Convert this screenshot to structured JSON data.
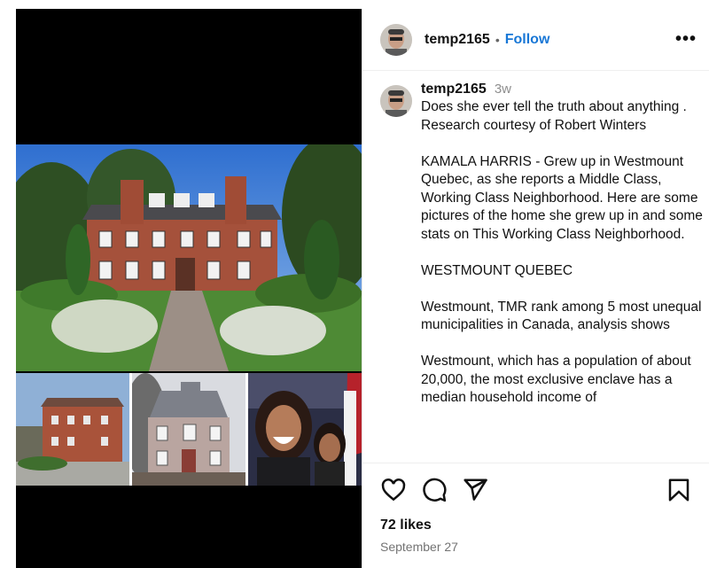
{
  "post": {
    "username": "temp2165",
    "follow_label": "Follow",
    "dot": "•",
    "more_label": "•••",
    "time": "3w",
    "caption": "Does she ever tell the truth about anything .\nResearch courtesy of Robert Winters\n\nKAMALA HARRIS - Grew up in Westmount Quebec, as she reports a Middle Class, Working Class Neighborhood. Here are some pictures of the home she grew up in and some stats on This Working Class Neighborhood.\n\nWESTMOUNT QUEBEC\n\nWestmount, TMR rank among 5 most unequal municipalities in Canada, analysis shows\n\nWestmount, which has a population of about 20,000, the most exclusive enclave has a median household income of",
    "likes": "72 likes",
    "date": "September 27"
  },
  "icons": {
    "like": "heart-icon",
    "comment": "comment-icon",
    "share": "paper-plane-icon",
    "save": "bookmark-icon",
    "more": "more-options-icon"
  },
  "colors": {
    "follow": "#1877d6",
    "media_background": "#000000"
  }
}
